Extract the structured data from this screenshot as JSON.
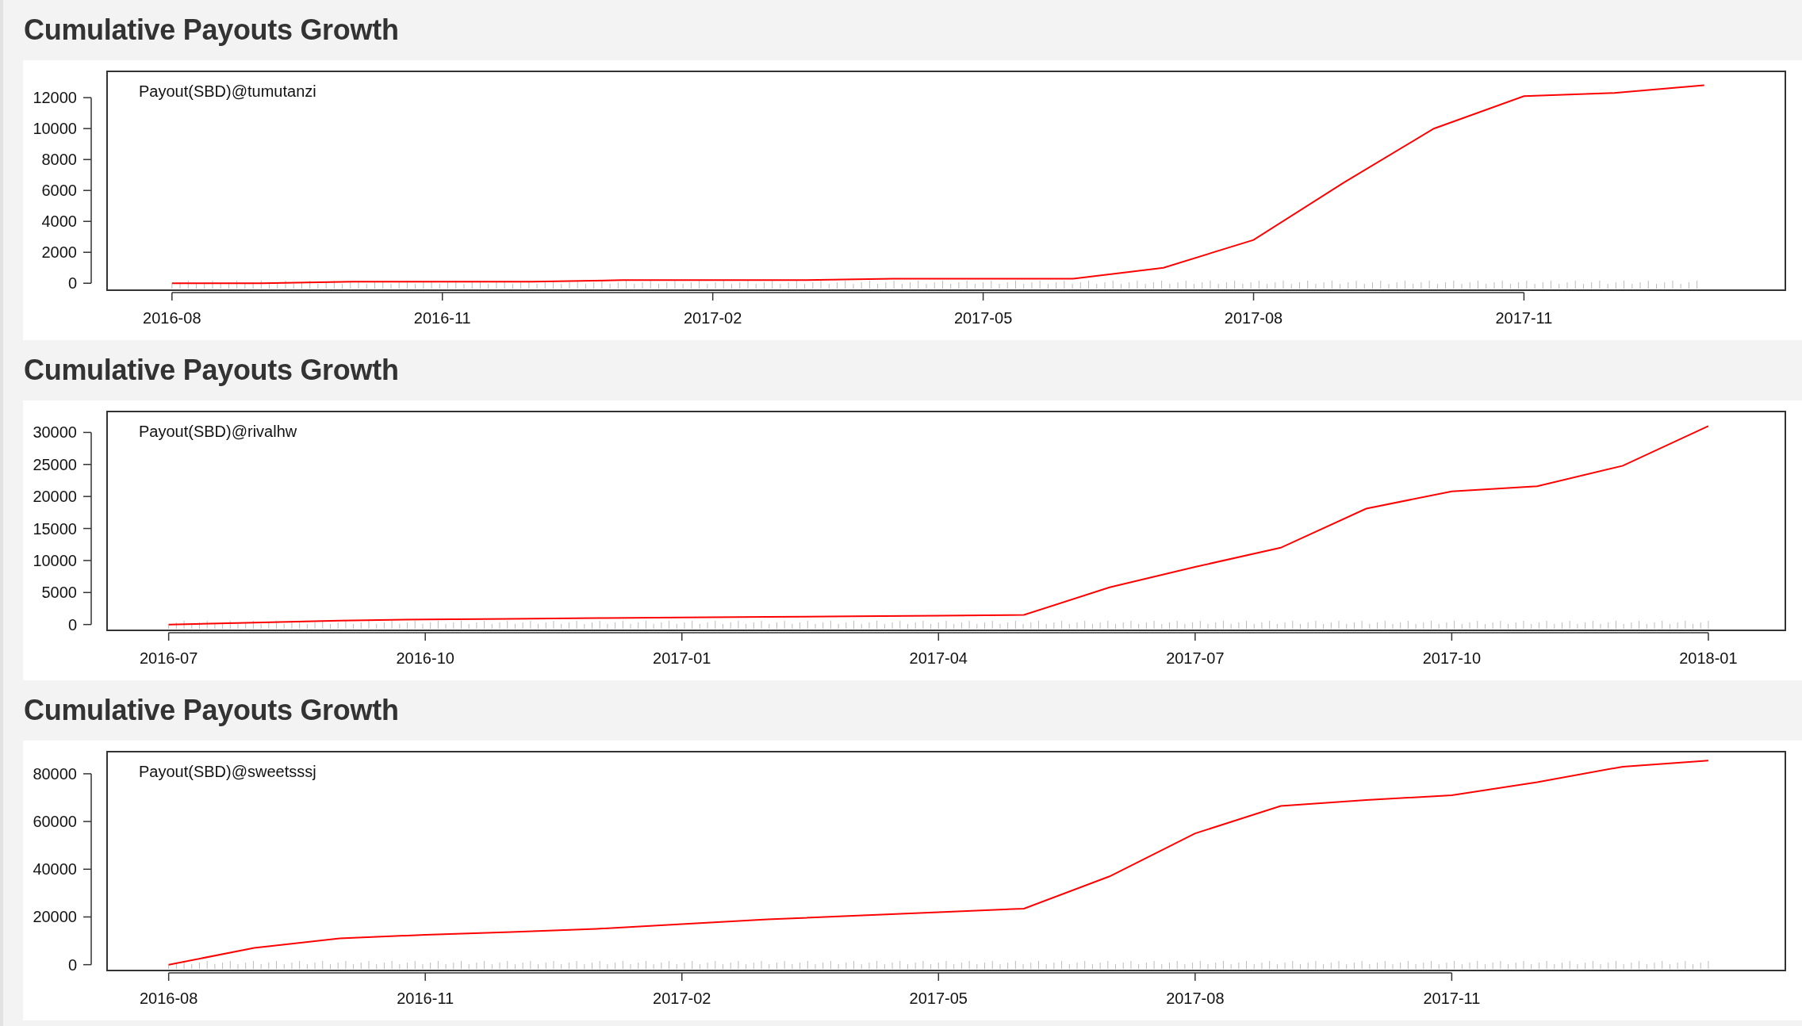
{
  "sections": [
    {
      "heading": "Cumulative Payouts Growth",
      "chart_data": {
        "type": "line",
        "categories": [
          "2016-08",
          null,
          null,
          "2016-11",
          null,
          null,
          "2017-02",
          null,
          null,
          "2017-05",
          null,
          null,
          "2017-08",
          null,
          null,
          "2017-11",
          null,
          null
        ],
        "ylim": [
          -450,
          13700
        ],
        "yticks": [
          0,
          2000,
          4000,
          6000,
          8000,
          10000,
          12000
        ],
        "series": [
          {
            "name": "Payout(SBD)@tumutanzi",
            "color": "#ff0000",
            "values": [
              0,
              0,
              100,
              100,
              100,
              200,
              200,
              200,
              300,
              300,
              300,
              1000,
              2800,
              6500,
              10000,
              12100,
              12300,
              12800
            ]
          }
        ]
      }
    },
    {
      "heading": "Cumulative Payouts Growth",
      "chart_data": {
        "type": "line",
        "categories": [
          "2016-07",
          null,
          null,
          "2016-10",
          null,
          null,
          "2017-01",
          null,
          null,
          "2017-04",
          null,
          null,
          "2017-07",
          null,
          null,
          "2017-10",
          null,
          null,
          "2018-01"
        ],
        "ylim": [
          -909,
          33270
        ],
        "yticks": [
          0,
          5000,
          10000,
          15000,
          20000,
          25000,
          30000
        ],
        "series": [
          {
            "name": "Payout(SBD)@rivalhw",
            "color": "#ff0000",
            "values": [
              0,
              300,
              600,
              800,
              900,
              1000,
              1100,
              1200,
              1300,
              1400,
              1500,
              5800,
              9000,
              12000,
              18100,
              20800,
              21600,
              24800,
              31000
            ]
          }
        ]
      }
    },
    {
      "heading": "Cumulative Payouts Growth",
      "chart_data": {
        "type": "line",
        "categories": [
          "2016-08",
          null,
          null,
          "2016-11",
          null,
          null,
          "2017-02",
          null,
          null,
          "2017-05",
          null,
          null,
          "2017-08",
          null,
          null,
          "2017-11",
          null,
          null,
          null
        ],
        "ylim": [
          -2440,
          89270
        ],
        "yticks": [
          0,
          20000,
          40000,
          60000,
          80000
        ],
        "series": [
          {
            "name": "Payout(SBD)@sweetsssj",
            "color": "#ff0000",
            "values": [
              0,
              7000,
              11000,
              12500,
              13700,
              15000,
              17000,
              19000,
              20500,
              22000,
              23500,
              37000,
              55000,
              66500,
              69000,
              71000,
              76500,
              83000,
              85500
            ]
          }
        ]
      }
    }
  ]
}
